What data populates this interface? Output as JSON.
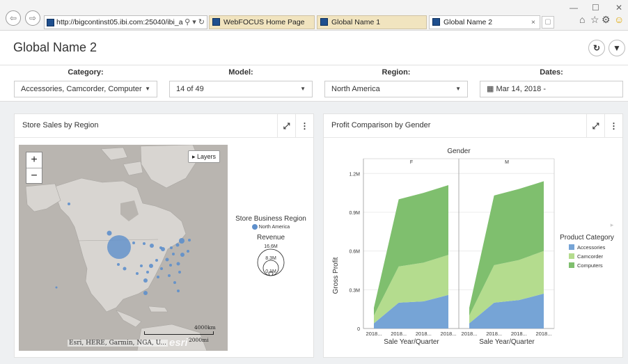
{
  "browser": {
    "address": "http://bigcontinst05.ibi.com:25040/ibi_a",
    "address_icons": "⚲ ▾ ↻",
    "tabs": [
      {
        "label": "WebFOCUS Home Page"
      },
      {
        "label": "Global Name 1"
      },
      {
        "label": "Global Name 2"
      }
    ],
    "tab_close": "×",
    "window_controls": [
      "—",
      "☐",
      "✕"
    ],
    "toolbar_icons": [
      "⌂",
      "☆",
      "⚙",
      "☺"
    ]
  },
  "header": {
    "title": "Global Name 2",
    "refresh_icon": "↻",
    "filter_icon": "▼"
  },
  "filters": [
    {
      "label": "Category:",
      "value": "Accessories, Camcorder, Computer",
      "caret": "▼"
    },
    {
      "label": "Model:",
      "value": "14 of 49",
      "caret": "▼"
    },
    {
      "label": "Region:",
      "value": "North America",
      "caret": "▼"
    },
    {
      "label": "Dates:",
      "value": "Mar 14, 2018 -",
      "icon": "▦"
    }
  ],
  "store_sales_panel": {
    "title": "Store Sales by Region",
    "expand_icon": "⤢",
    "menu_icon": "⋮",
    "zoom_in": "+",
    "zoom_out": "−",
    "layers_label": "▸ Layers",
    "attribution": "Esri, HERE, Garmin, NGA, U...",
    "esri_logo": "esri",
    "scale_km": "4000km",
    "scale_mi": "2000mi",
    "legend": {
      "title": "Store Business Region",
      "item": "North America",
      "size_title": "Revenue",
      "size_labels": [
        "16.6M",
        "8.3M",
        "0.1M"
      ]
    },
    "colors": {
      "bubble": "#5e8fcb",
      "map_bg": "#b9b5b0",
      "land": "#d8d5d1"
    }
  },
  "profit_panel": {
    "title": "Profit Comparison by Gender",
    "expand_icon": "⤢",
    "menu_icon": "⋮",
    "legend_arrow": "▸"
  },
  "chart_data": {
    "type": "area",
    "title": "Gender",
    "panels": [
      "F",
      "M"
    ],
    "xlabel": "Sale Year/Quarter",
    "ylabel": "Gross Profit",
    "x_tick_labels": [
      "2018...",
      "2018...",
      "2018...",
      "2018..."
    ],
    "y_ticks": [
      "0",
      "0.3M",
      "0.6M",
      "0.9M",
      "1.2M"
    ],
    "ylim": [
      0,
      1.25
    ],
    "stacked": true,
    "legend_title": "Product Category",
    "legend_position": "right",
    "series": [
      {
        "name": "Accessories",
        "color": "#76a4d6",
        "F": [
          0.04,
          0.2,
          0.21,
          0.26
        ],
        "M": [
          0.04,
          0.2,
          0.22,
          0.27
        ]
      },
      {
        "name": "Camcorder",
        "color": "#b4dc8e",
        "F": [
          0.06,
          0.28,
          0.3,
          0.31
        ],
        "M": [
          0.06,
          0.29,
          0.31,
          0.33
        ]
      },
      {
        "name": "Computers",
        "color": "#7fbf6e",
        "F": [
          0.06,
          0.52,
          0.54,
          0.54
        ],
        "M": [
          0.06,
          0.54,
          0.55,
          0.54
        ]
      }
    ]
  }
}
